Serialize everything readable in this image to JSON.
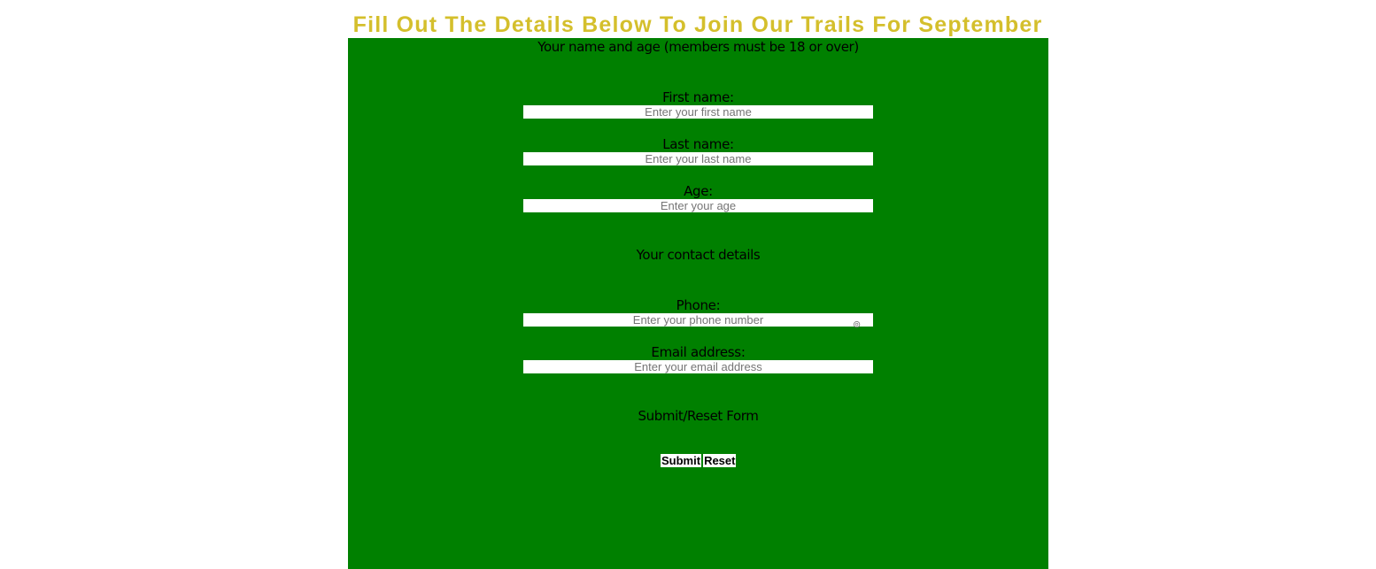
{
  "page": {
    "title": "Fill Out The Details Below To Join Our Trails For September"
  },
  "colors": {
    "title": "#d4bf2c",
    "panel_background": "#008000",
    "field_background": "#ffffff",
    "placeholder": "#757575"
  },
  "sections": {
    "name_age": {
      "legend": "Your name and age (members must be 18 or over)",
      "first_name": {
        "label": "First name:",
        "value": "",
        "placeholder": "Enter your first name"
      },
      "last_name": {
        "label": "Last name:",
        "value": "",
        "placeholder": "Enter your last name"
      },
      "age": {
        "label": "Age:",
        "value": "",
        "placeholder": "Enter your age"
      }
    },
    "contact": {
      "legend": "Your contact details",
      "phone": {
        "label": "Phone:",
        "value": "",
        "placeholder": "Enter your phone number",
        "icon": "autofill-icon"
      },
      "email": {
        "label": "Email address:",
        "value": "",
        "placeholder": "Enter your email address"
      }
    },
    "actions": {
      "legend": "Submit/Reset Form",
      "submit_label": "Submit",
      "reset_label": "Reset"
    }
  }
}
